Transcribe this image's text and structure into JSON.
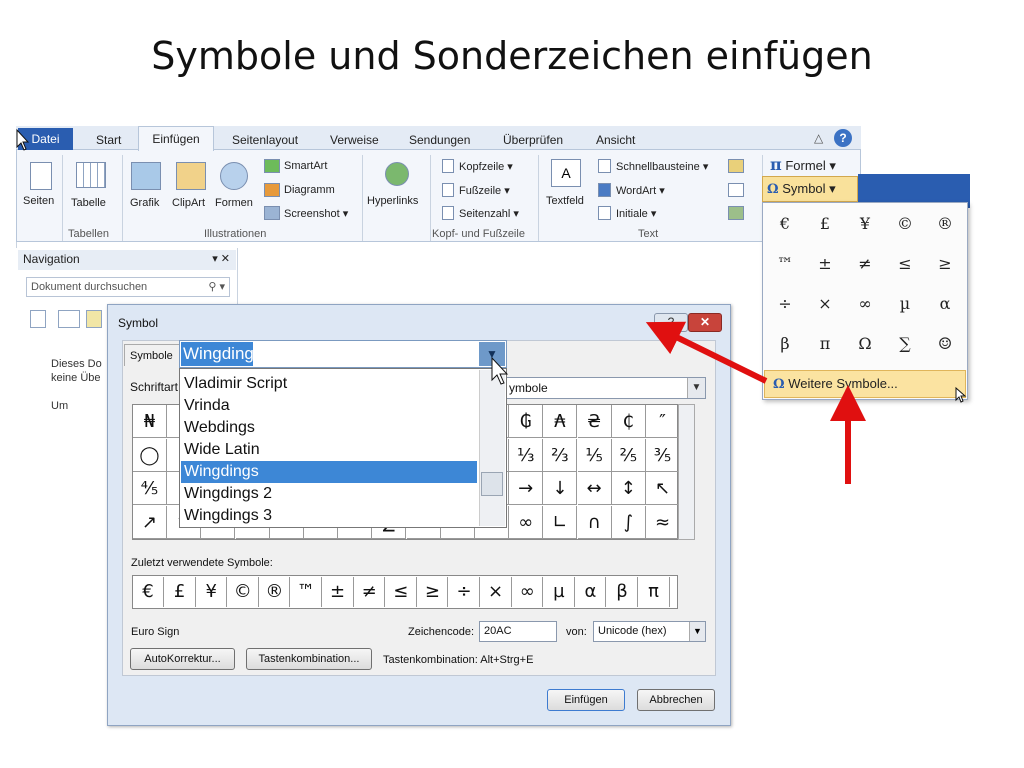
{
  "slide_title": "Symbole und Sonderzeichen einfügen",
  "ribbon": {
    "tabs": [
      "Datei",
      "Start",
      "Einfügen",
      "Seitenlayout",
      "Verweise",
      "Sendungen",
      "Überprüfen",
      "Ansicht"
    ],
    "seiten": "Seiten",
    "tabelle": "Tabelle",
    "grafik": "Grafik",
    "clipart": "ClipArt",
    "formen": "Formen",
    "smartart": "SmartArt",
    "diagramm": "Diagramm",
    "screenshot": "Screenshot ▾",
    "hyperlinks": "Hyperlinks",
    "kopfzeile": "Kopfzeile ▾",
    "fusszeile": "Fußzeile ▾",
    "seitenzahl": "Seitenzahl ▾",
    "textfeld": "Textfeld",
    "schnellbausteine": "Schnellbausteine ▾",
    "wordart": "WordArt ▾",
    "initiale": "Initiale ▾",
    "formel": "Formel ▾",
    "symbol": "Symbol ▾",
    "groups": [
      "Tabellen",
      "Illustrationen",
      "Kopf- und Fußzeile",
      "Text"
    ]
  },
  "navigation": {
    "title": "Navigation",
    "search_placeholder": "Dokument durchsuchen",
    "text_line1": "Dieses Do",
    "text_line2": "keine Übe",
    "text_line3": "Um"
  },
  "symbol_dropdown": {
    "symbols": [
      "€",
      "£",
      "¥",
      "©",
      "®",
      "™",
      "±",
      "≠",
      "≤",
      "≥",
      "÷",
      "×",
      "∞",
      "µ",
      "α",
      "β",
      "π",
      "Ω",
      "∑",
      "☺"
    ],
    "more_label": "Weitere Symbole..."
  },
  "dialog": {
    "title": "Symbol",
    "tab_symbole": "Symbole",
    "font_label": "Schriftart",
    "font_selected": "Wingdings",
    "font_list": [
      "Vladimir Script",
      "Vrinda",
      "Webdings",
      "Wide Latin",
      "Wingdings",
      "Wingdings 2",
      "Wingdings 3"
    ],
    "subset_value": "ymbole",
    "grid_visible": [
      [
        "₦",
        "P",
        "",
        "",
        "",
        "",
        "",
        "",
        "",
        "",
        "",
        "₲",
        "₳",
        "₴",
        "₵",
        "″"
      ],
      [
        "◯",
        "c",
        "",
        "",
        "",
        "",
        "",
        "",
        "",
        "",
        "",
        "⅓",
        "⅔",
        "⅕",
        "⅖",
        "⅗"
      ],
      [
        "⅘",
        "¹",
        "",
        "",
        "",
        "",
        "",
        "",
        "",
        "",
        "",
        "→",
        "↓",
        "↔",
        "↕",
        "↖"
      ],
      [
        "↗",
        "↘",
        "≟",
        "≠",
        "≡",
        "≥",
        "≤",
        "∑",
        "",
        "",
        "",
        "∞",
        "∟",
        "∩",
        "∫",
        "≈"
      ]
    ],
    "recent_label": "Zuletzt verwendete Symbole:",
    "recent_symbols": [
      "€",
      "£",
      "¥",
      "©",
      "®",
      "™",
      "±",
      "≠",
      "≤",
      "≥",
      "÷",
      "×",
      "∞",
      "µ",
      "α",
      "β",
      "π"
    ],
    "char_name": "Euro Sign",
    "code_label": "Zeichencode:",
    "code_value": "20AC",
    "von_label": "von:",
    "von_value": "Unicode (hex)",
    "autokorrektur": "AutoKorrektur...",
    "tastenkombination": "Tastenkombination...",
    "shortcut_info": "Tastenkombination: Alt+Strg+E",
    "einfuegen": "Einfügen",
    "abbrechen": "Abbrechen"
  },
  "colors": {
    "accent": "#2a5db0",
    "arrow": "#e01010",
    "highlight": "#3d87d6"
  }
}
